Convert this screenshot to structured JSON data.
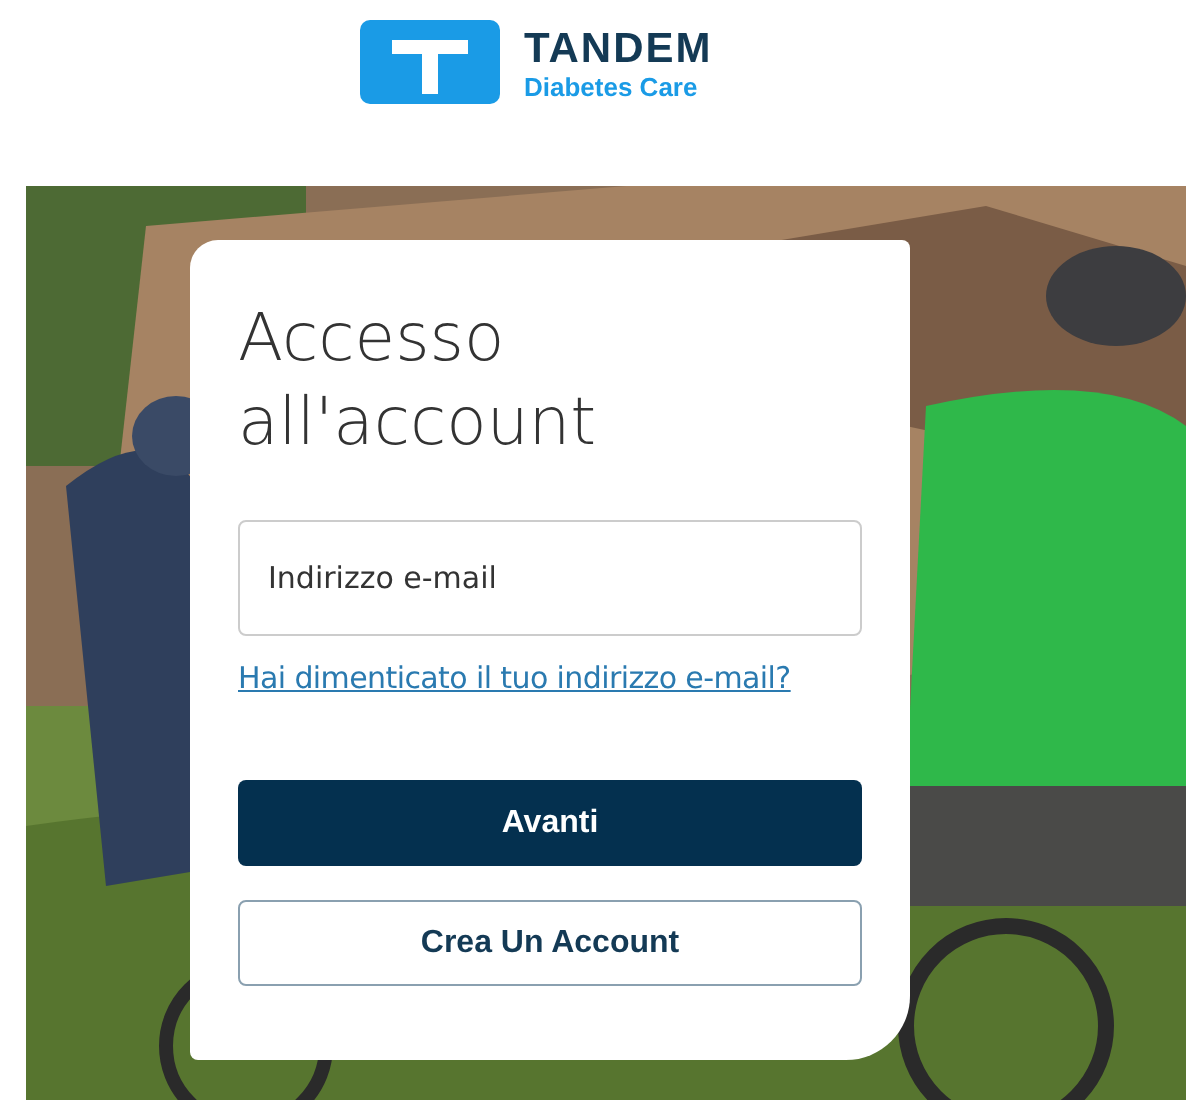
{
  "logo": {
    "name": "TANDEM",
    "tagline": "Diabetes Care"
  },
  "login": {
    "title": "Accesso all'account",
    "email": {
      "placeholder": "Indirizzo e-mail"
    },
    "forgot_link": "Hai dimenticato il tuo indirizzo e-mail?",
    "buttons": [
      {
        "label": "Avanti",
        "kind": "primary"
      },
      {
        "label": "Crea Un Account",
        "kind": "secondary"
      }
    ]
  }
}
